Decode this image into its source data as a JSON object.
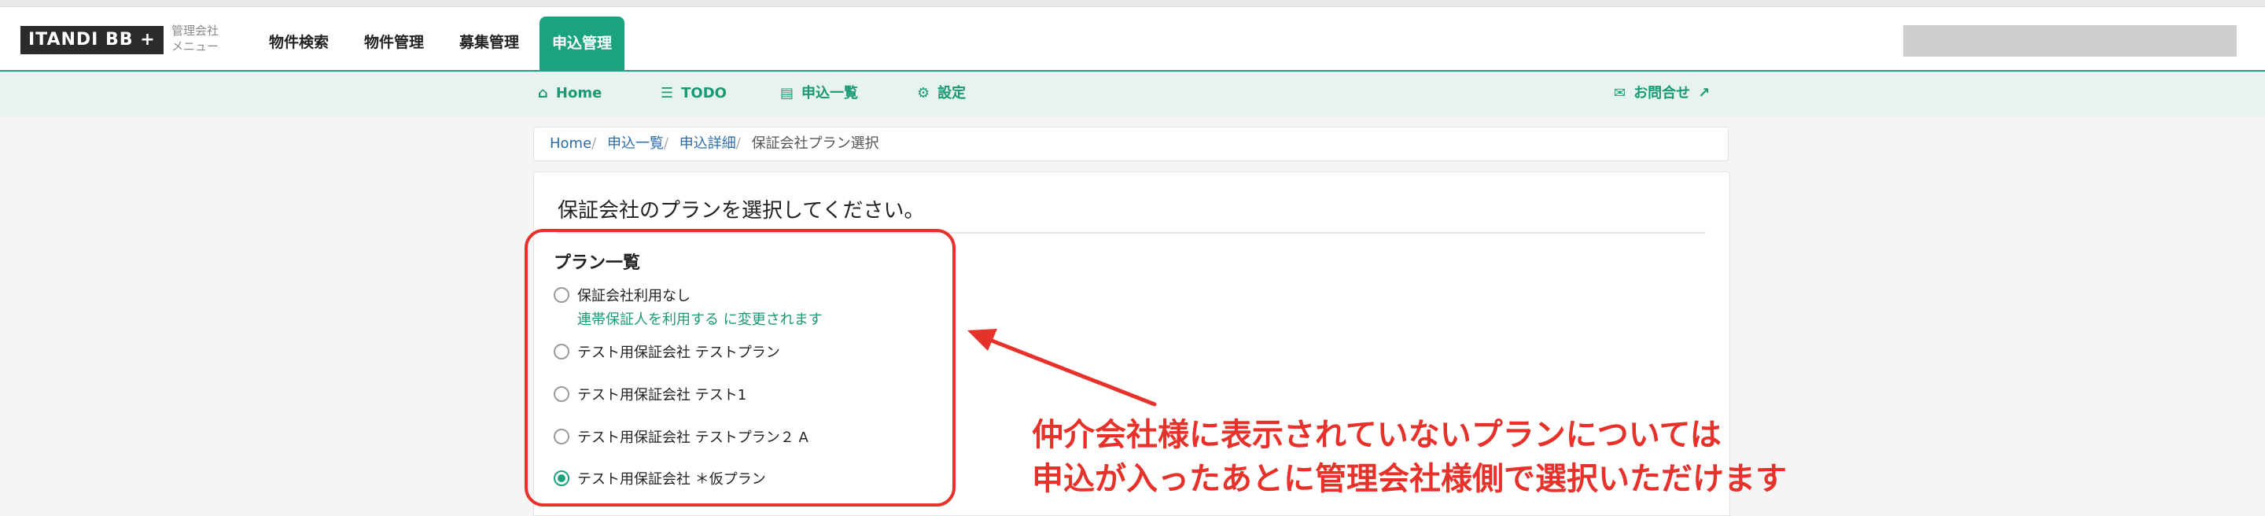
{
  "header": {
    "logo": "ITANDI BB +",
    "menu_label_top": "管理会社",
    "menu_label_bottom": "メニュー",
    "nav": [
      {
        "label": "物件検索"
      },
      {
        "label": "物件管理"
      },
      {
        "label": "募集管理"
      },
      {
        "label": "申込管理",
        "active": true
      }
    ]
  },
  "subnav": {
    "home": "Home",
    "todo": "TODO",
    "list": "申込一覧",
    "settings": "設定",
    "contact": "お問合せ"
  },
  "breadcrumb": {
    "items": [
      "Home",
      "申込一覧",
      "申込詳細"
    ],
    "current": "保証会社プラン選択"
  },
  "panel": {
    "title": "保証会社のプランを選択してください。",
    "plan_heading": "プラン一覧",
    "plans": [
      {
        "label": "保証会社利用なし",
        "checked": false
      },
      {
        "label": "テスト用保証会社 テストプラン",
        "checked": false
      },
      {
        "label": "テスト用保証会社 テスト1",
        "checked": false
      },
      {
        "label": "テスト用保証会社 テストプラン２ A",
        "checked": false
      },
      {
        "label": "テスト用保証会社 ＊仮プラン",
        "checked": true
      }
    ],
    "plan_note": "連帯保証人を利用する に変更されます"
  },
  "annotation": {
    "line1": "仲介会社様に表示されていないプランについては",
    "line2": "申込が入ったあとに管理会社様側で選択いただけます"
  },
  "colors": {
    "brand_green": "#1aa37e",
    "annotation_red": "#e6322a"
  }
}
